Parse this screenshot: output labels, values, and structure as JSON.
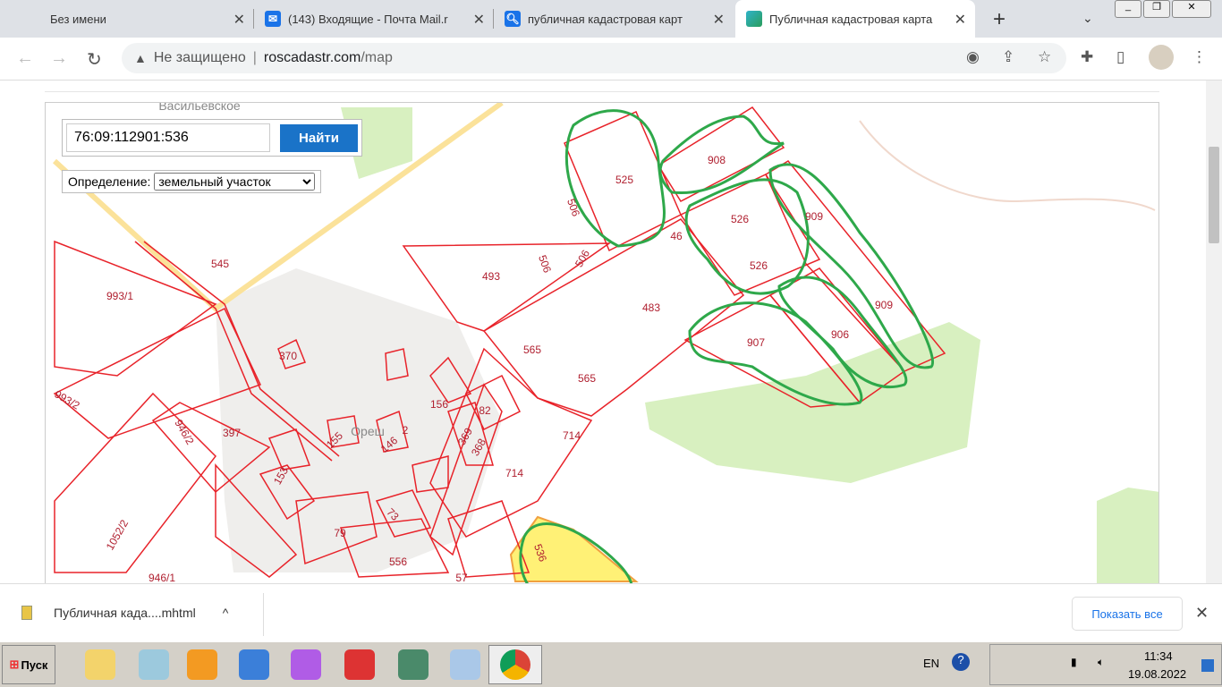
{
  "browser": {
    "tabs": [
      {
        "title": "Без имени",
        "icon": "none",
        "active": false
      },
      {
        "title": "(143) Входящие - Почта Mail.r",
        "icon": "mail-icon",
        "active": false
      },
      {
        "title": "публичная кадастровая карт",
        "icon": "search-icon",
        "active": false
      },
      {
        "title": "Публичная кадастровая карта",
        "icon": "cadastre-icon",
        "active": true
      }
    ],
    "new_tab": "+",
    "address": {
      "security": "Не защищено",
      "host": "roscadastr.com",
      "path": "/map"
    }
  },
  "map": {
    "search_value": "76:09:112901:536",
    "search_button": "Найти",
    "definition_label": "Определение:",
    "definition_selected": "земельный участок",
    "place_labels": [
      "Васильевское",
      "Ореш"
    ],
    "parcel_labels": [
      "525",
      "908",
      "506",
      "526",
      "909",
      "46",
      "545",
      "493",
      "506",
      "506",
      "526",
      "993/1",
      "483",
      "909",
      "370",
      "565",
      "907",
      "906",
      "993/2",
      "565",
      "156",
      "82",
      "946/2",
      "397",
      "2",
      "369",
      "714",
      "155",
      "146",
      "368",
      "153",
      "714",
      "73",
      "79",
      "1052/2",
      "536",
      "556",
      "946/1",
      "57"
    ],
    "colors": {
      "parcel": "#e8232a",
      "highlight": "#2ea84a",
      "selected": "#fff176",
      "forest": "#d8f0c0",
      "settlement": "#efeeec"
    }
  },
  "downloads": {
    "file": "Публичная када....mhtml",
    "show_all": "Показать все"
  },
  "taskbar": {
    "start": "Пуск",
    "lang": "EN",
    "time": "11:34",
    "date": "19.08.2022"
  }
}
